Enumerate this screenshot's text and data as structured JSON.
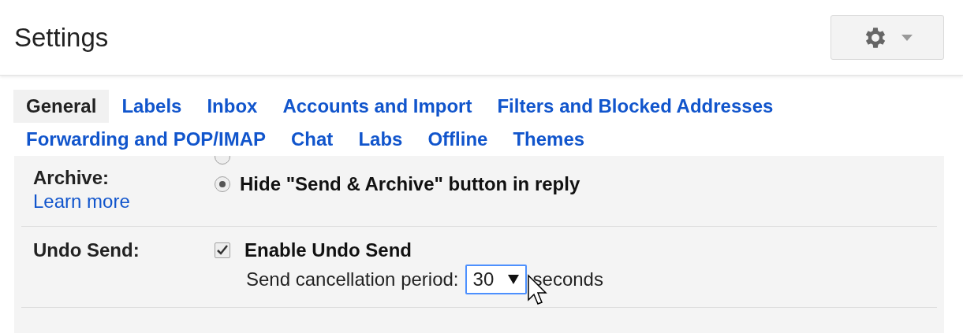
{
  "header": {
    "title": "Settings"
  },
  "tabs": [
    {
      "label": "General",
      "selected": true
    },
    {
      "label": "Labels",
      "selected": false
    },
    {
      "label": "Inbox",
      "selected": false
    },
    {
      "label": "Accounts and Import",
      "selected": false
    },
    {
      "label": "Filters and Blocked Addresses",
      "selected": false
    },
    {
      "label": "Forwarding and POP/IMAP",
      "selected": false
    },
    {
      "label": "Chat",
      "selected": false
    },
    {
      "label": "Labs",
      "selected": false
    },
    {
      "label": "Offline",
      "selected": false
    },
    {
      "label": "Themes",
      "selected": false
    }
  ],
  "sections": [
    {
      "label": "Archive:",
      "link": "Learn more",
      "options": [
        {
          "kind": "radio",
          "selected": false
        },
        {
          "kind": "radio",
          "label": "Hide \"Send & Archive\" button in reply",
          "selected": true
        }
      ]
    },
    {
      "label": "Undo Send:",
      "options": [
        {
          "kind": "checkbox",
          "label": "Enable Undo Send",
          "checked": true
        }
      ],
      "period": {
        "label": "Send cancellation period:",
        "value": "30",
        "unit": "seconds"
      }
    }
  ]
}
